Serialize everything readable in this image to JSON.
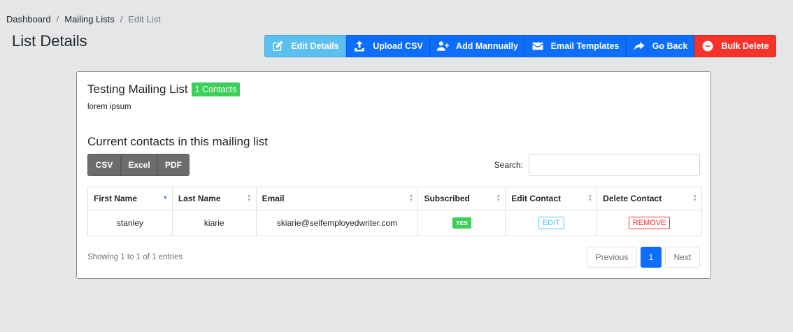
{
  "breadcrumb": [
    {
      "label": "Dashboard"
    },
    {
      "label": "Mailing Lists"
    },
    {
      "label": "Edit List"
    }
  ],
  "page_title": "List Details",
  "toolbar": {
    "edit_details": "Edit Details",
    "upload_csv": "Upload CSV",
    "add_manually": "Add Mannually",
    "email_templates": "Email Templates",
    "go_back": "Go Back",
    "bulk_delete": "Bulk Delete"
  },
  "list": {
    "name": "Testing Mailing List",
    "contacts_badge": "1 Contacts",
    "description": "lorem ipsum"
  },
  "section_title": "Current contacts in this mailing list",
  "export": {
    "csv": "CSV",
    "excel": "Excel",
    "pdf": "PDF"
  },
  "search": {
    "label": "Search:",
    "value": ""
  },
  "table": {
    "headers": [
      "First Name",
      "Last Name",
      "Email",
      "Subscribed",
      "Edit Contact",
      "Delete Contact"
    ],
    "rows": [
      {
        "first_name": "stanley",
        "last_name": "kiarie",
        "email": "skiarie@selfemployedwriter.com",
        "subscribed": "YES",
        "edit": "EDIT",
        "remove": "REMOVE"
      }
    ]
  },
  "info": "Showing 1 to 1 of 1 entries",
  "pagination": {
    "previous": "Previous",
    "current": "1",
    "next": "Next"
  },
  "colors": {
    "info": "#5bc0f0",
    "primary": "#0d6efd",
    "danger": "#f5332b",
    "success": "#3ecf5a"
  }
}
